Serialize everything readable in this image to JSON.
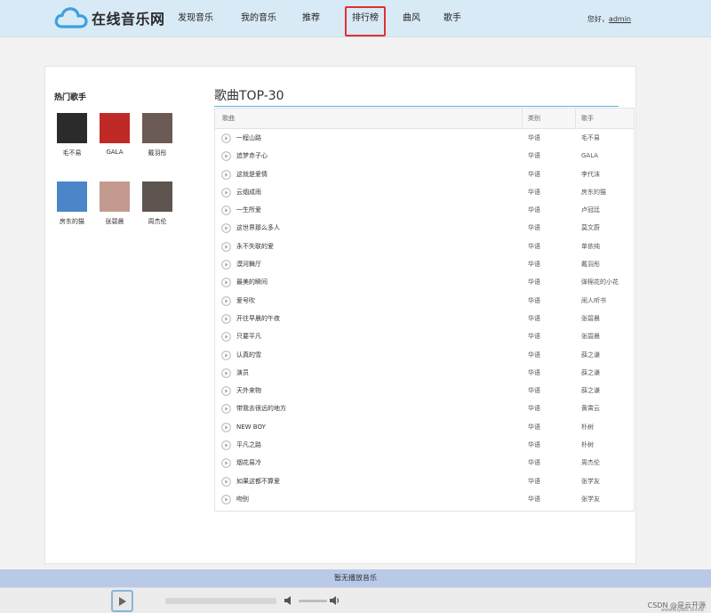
{
  "header": {
    "logo_text": "在线音乐网",
    "nav": [
      "发现音乐",
      "我的音乐",
      "推荐",
      "排行榜",
      "曲风",
      "歌手"
    ],
    "active_nav": "排行榜",
    "greeting_prefix": "您好，",
    "user": "admin"
  },
  "sidebar": {
    "title": "热门歌手",
    "artists": [
      {
        "name": "毛不易",
        "color": "#2b2b2b"
      },
      {
        "name": "GALA",
        "color": "#c02a26"
      },
      {
        "name": "戴羽彤",
        "color": "#6c5a55"
      },
      {
        "name": "房东的猫",
        "color": "#4a86c8"
      },
      {
        "name": "张碧晨",
        "color": "#c49a8e"
      },
      {
        "name": "周杰伦",
        "color": "#5e5550"
      }
    ]
  },
  "chart": {
    "title": "歌曲TOP-30",
    "columns": {
      "song": "歌曲",
      "category": "类别",
      "singer": "歌手"
    },
    "rows": [
      {
        "song": "一程山路",
        "category": "华语",
        "singer": "毛不易"
      },
      {
        "song": "追梦赤子心",
        "category": "华语",
        "singer": "GALA"
      },
      {
        "song": "这就是爱情",
        "category": "华语",
        "singer": "李代沫"
      },
      {
        "song": "云烟成雨",
        "category": "华语",
        "singer": "房东的猫"
      },
      {
        "song": "一生所爱",
        "category": "华语",
        "singer": "卢冠廷"
      },
      {
        "song": "这世界那么多人",
        "category": "华语",
        "singer": "莫文蔚"
      },
      {
        "song": "永不失联的爱",
        "category": "华语",
        "singer": "单依纯"
      },
      {
        "song": "漠河舞厅",
        "category": "华语",
        "singer": "戴羽彤"
      },
      {
        "song": "最美的瞬间",
        "category": "华语",
        "singer": "弹棉花的小花"
      },
      {
        "song": "爱号吹",
        "category": "华语",
        "singer": "闹人听书"
      },
      {
        "song": "开往早晨的午夜",
        "category": "华语",
        "singer": "张碧晨"
      },
      {
        "song": "只要平凡",
        "category": "华语",
        "singer": "张碧晨"
      },
      {
        "song": "认真的雪",
        "category": "华语",
        "singer": "薛之谦"
      },
      {
        "song": "演员",
        "category": "华语",
        "singer": "薛之谦"
      },
      {
        "song": "天外来物",
        "category": "华语",
        "singer": "薛之谦"
      },
      {
        "song": "带我去很远的地方",
        "category": "华语",
        "singer": "黄霄云"
      },
      {
        "song": "NEW BOY",
        "category": "华语",
        "singer": "朴树"
      },
      {
        "song": "平凡之路",
        "category": "华语",
        "singer": "朴树"
      },
      {
        "song": "烟花易冷",
        "category": "华语",
        "singer": "周杰伦"
      },
      {
        "song": "如果这都不算爱",
        "category": "华语",
        "singer": "张学友"
      },
      {
        "song": "吻别",
        "category": "华语",
        "singer": "张学友"
      }
    ]
  },
  "player": {
    "status": "暂无播放音乐"
  },
  "watermark": "CSDN @是云开源",
  "watermark_url": "www.kuyabc.online",
  "colors": {
    "header_bg": "#d9eaf7",
    "accent": "#5ab5de",
    "active_border": "#e03030",
    "player_status_bg": "#b9c9e8"
  }
}
